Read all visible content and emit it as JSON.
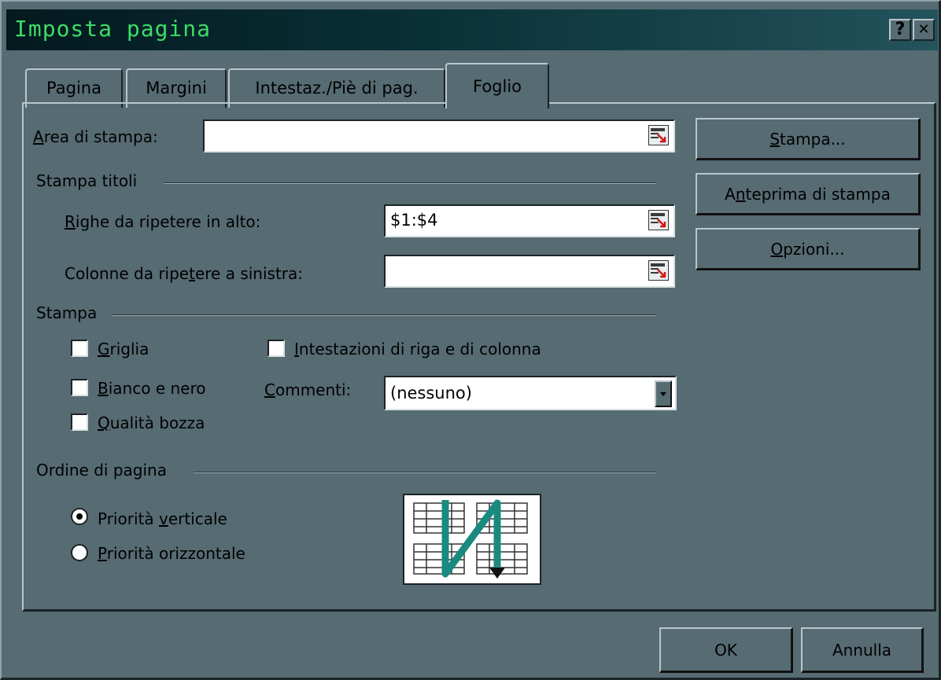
{
  "window": {
    "title": "Imposta pagina",
    "help_button": "?",
    "close_button": "✕"
  },
  "tabs": [
    {
      "label": "Pagina"
    },
    {
      "label": "Margini"
    },
    {
      "label": "Intestaz./Piè di pag."
    },
    {
      "label": "Foglio",
      "active": true
    }
  ],
  "print_area": {
    "label_prefix": "A",
    "label_rest": "rea di stampa:",
    "value": ""
  },
  "print_titles": {
    "group_label": "Stampa titoli",
    "rows_label_prefix": "R",
    "rows_label_rest": "ighe da ripetere in alto:",
    "rows_value": "$1:$4",
    "cols_label_a": "Colonne da ripe",
    "cols_label_u": "t",
    "cols_label_b": "ere a sinistra:",
    "cols_value": ""
  },
  "print": {
    "group_label": "Stampa",
    "gridlines_u": "G",
    "gridlines_rest": "riglia",
    "bw_u": "B",
    "bw_rest": "ianco e nero",
    "draft_u": "Q",
    "draft_rest": "ualità bozza",
    "headings_u": "I",
    "headings_rest": "ntestazioni di riga e di colonna",
    "comments_u": "C",
    "comments_rest": "ommenti:",
    "comments_value": "(nessuno)"
  },
  "page_order": {
    "group_label": "Ordine di pagina",
    "down_a": "Priorità ",
    "down_u": "v",
    "down_b": "erticale",
    "over_u": "P",
    "over_rest": "riorità orizzontale",
    "selected": "down"
  },
  "side_buttons": {
    "print_u": "S",
    "print_rest": "tampa...",
    "preview_a": "A",
    "preview_u": "n",
    "preview_b": "teprima di stampa",
    "options_u": "O",
    "options_rest": "pzioni..."
  },
  "footer": {
    "ok": "OK",
    "cancel": "Annulla"
  },
  "colors": {
    "dialog_bg": "#566b72",
    "title_text": "#3ddc66",
    "preview_arrow": "#1a8a80"
  }
}
